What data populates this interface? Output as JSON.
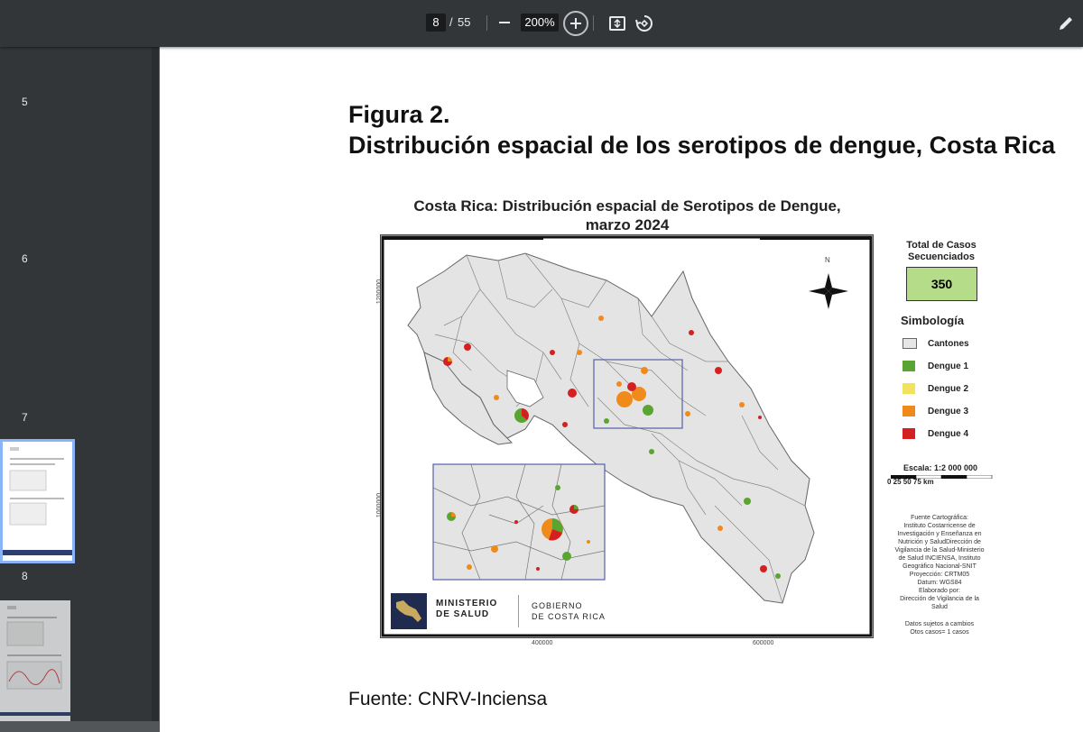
{
  "toolbar": {
    "current_page": "8",
    "page_separator": "/",
    "total_pages": "55",
    "zoom": "200%"
  },
  "sidebar": {
    "thumbnails": [
      {
        "label": "5"
      },
      {
        "label": "6"
      },
      {
        "label": "7"
      },
      {
        "label": "8"
      }
    ]
  },
  "page": {
    "figure_title_line1": "Figura 2.",
    "figure_title_line2": "Distribución espacial de los serotipos de dengue, Costa Rica",
    "source": "Fuente: CNRV-Inciensa",
    "map": {
      "title_line1": "Costa Rica: Distribución espacial de Serotipos de Dengue,",
      "title_line2": "marzo 2024",
      "north": "N",
      "axis_y_top": "1200000",
      "axis_y_bottom": "1000000",
      "axis_x_left": "400000",
      "axis_x_right": "600000",
      "total_title_line1": "Total de Casos",
      "total_title_line2": "Secuenciados",
      "total_value": "350",
      "legend_title": "Simbología",
      "legend": [
        {
          "label": "Cantones",
          "color": "#e6e6e6"
        },
        {
          "label": "Dengue 1",
          "color": "#5aa532"
        },
        {
          "label": "Dengue 2",
          "color": "#f2e25e"
        },
        {
          "label": "Dengue 3",
          "color": "#f08a1a"
        },
        {
          "label": "Dengue 4",
          "color": "#d42020"
        }
      ],
      "scale_label": "Escala:   1:2 000 000",
      "scale_ticks": "0      25      50      75 km",
      "credits": [
        "Fuente Cartográfica:",
        "Instituto Costarricense de",
        "Investigación y Enseñanza en",
        "Nutrición y SaludDirección de",
        "Vigilancia de la Salud-Ministerio",
        "de Salud INCIENSA, Instituto",
        "Geográfico Nacional-SNIT",
        "Proyección: CRTM05",
        "Datum: WGS84",
        "Elaborado por:",
        "Dirección de Vigilancia de la",
        "Salud"
      ],
      "disclaimer_line1": "Datos sujetos a cambios",
      "disclaimer_line2": "Otos casos= 1 casos",
      "logo_ministry_line1": "MINISTERIO",
      "logo_ministry_line2": "DE SALUD",
      "logo_gov_line1": "GOBIERNO",
      "logo_gov_line2": "DE COSTA RICA"
    }
  }
}
